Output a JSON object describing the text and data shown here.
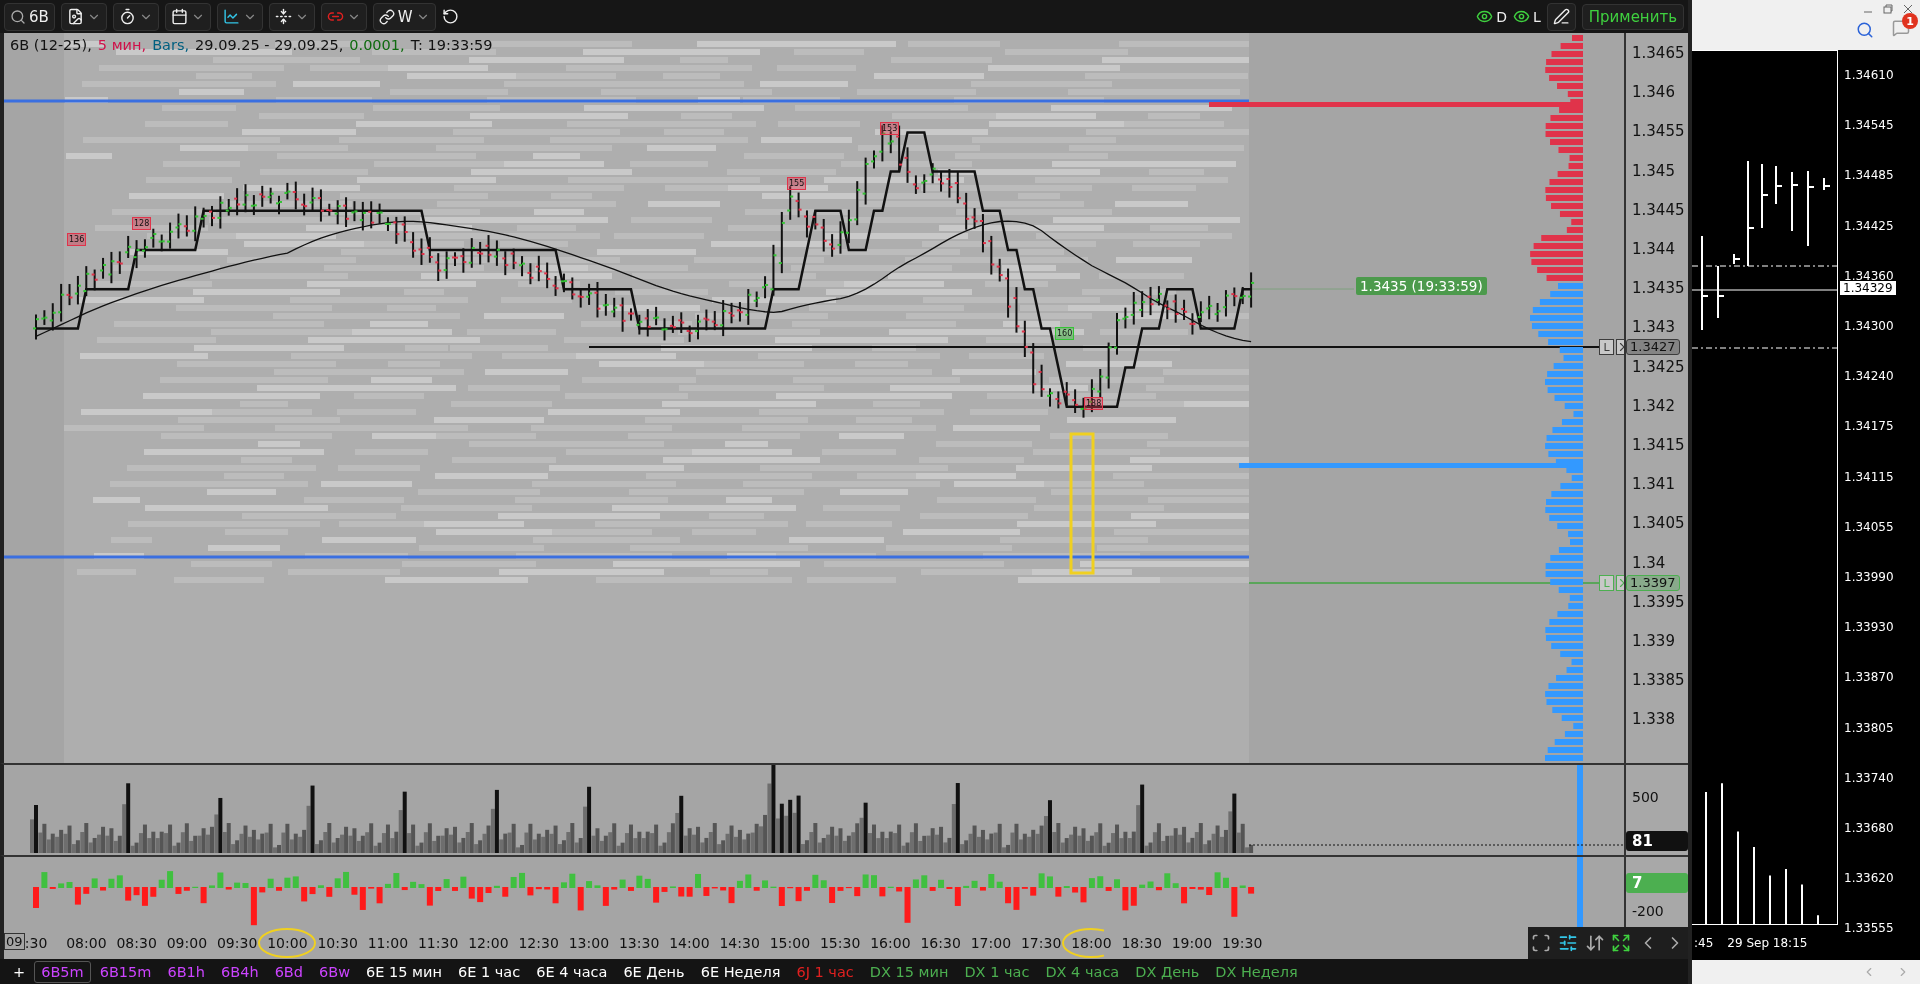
{
  "toolbar": {
    "symbol": "6B",
    "link_label": "W",
    "toggles": [
      {
        "label": "D",
        "on": true
      },
      {
        "label": "L",
        "on": true
      }
    ],
    "apply_button": "Применить"
  },
  "chart_info": [
    {
      "kind": "symbol",
      "text": "6B  (12-25),"
    },
    {
      "kind": "interval",
      "text": "5 мин,"
    },
    {
      "kind": "type",
      "text": "Bars,"
    },
    {
      "kind": "range",
      "text": "29.09.25 - 29.09.25,"
    },
    {
      "kind": "tick",
      "text": "0.0001,"
    },
    {
      "kind": "time",
      "text": "T: 19:33:59"
    }
  ],
  "trade_markers": [
    {
      "label": "136",
      "kind": "sell"
    },
    {
      "label": "128",
      "kind": "sell"
    },
    {
      "label": "155",
      "kind": "sell"
    },
    {
      "label": "153",
      "kind": "sell"
    },
    {
      "label": "160",
      "kind": "buy"
    },
    {
      "label": "138",
      "kind": "sell"
    }
  ],
  "last_price_tag": "1.3435 (19:33:59)",
  "price_axis": {
    "labels": [
      "1.3465",
      "1.346",
      "1.3455",
      "1.345",
      "1.3445",
      "1.344",
      "1.3435",
      "1.343",
      "1.3425",
      "1.342",
      "1.3415",
      "1.341",
      "1.3405",
      "1.34",
      "1.3395",
      "1.339",
      "1.3385",
      "1.338"
    ]
  },
  "order_lines": [
    {
      "price": "1.3427",
      "button": "L",
      "color": "#3c3c3c"
    },
    {
      "price": "1.3397",
      "button": "L",
      "color": "#4caf50"
    }
  ],
  "volume_axis": {
    "label": "500",
    "last": "81"
  },
  "delta_axis": {
    "last": "7",
    "label": "-200"
  },
  "time_axis": {
    "date_box": "09",
    "labels": [
      ":30",
      "08:00",
      "08:30",
      "09:00",
      "09:30",
      "10:00",
      "10:30",
      "11:00",
      "11:30",
      "12:00",
      "12:30",
      "13:00",
      "13:30",
      "14:00",
      "14:30",
      "15:00",
      "15:30",
      "16:00",
      "16:30",
      "17:00",
      "17:30",
      "18:00",
      "18:30",
      "19:00",
      "19:30"
    ]
  },
  "tabs": [
    {
      "label": "+",
      "color": "#ffffff",
      "selected": false
    },
    {
      "label": "6B5m",
      "color": "#cc44ff",
      "selected": true
    },
    {
      "label": "6B15m",
      "color": "#cc44ff",
      "selected": false
    },
    {
      "label": "6B1h",
      "color": "#cc44ff",
      "selected": false
    },
    {
      "label": "6B4h",
      "color": "#cc44ff",
      "selected": false
    },
    {
      "label": "6Bd",
      "color": "#cc44ff",
      "selected": false
    },
    {
      "label": "6Bw",
      "color": "#cc44ff",
      "selected": false
    },
    {
      "label": "6E 15 мин",
      "color": "#ffffff",
      "selected": false
    },
    {
      "label": "6E 1 час",
      "color": "#ffffff",
      "selected": false
    },
    {
      "label": "6E 4 часа",
      "color": "#ffffff",
      "selected": false
    },
    {
      "label": "6E День",
      "color": "#ffffff",
      "selected": false
    },
    {
      "label": "6E Неделя",
      "color": "#ffffff",
      "selected": false
    },
    {
      "label": "6J 1 час",
      "color": "#e02020",
      "selected": false
    },
    {
      "label": "DX 15 мин",
      "color": "#4caf50",
      "selected": false
    },
    {
      "label": "DX 1 час",
      "color": "#4caf50",
      "selected": false
    },
    {
      "label": "DX 4 часа",
      "color": "#4caf50",
      "selected": false
    },
    {
      "label": "DX День",
      "color": "#4caf50",
      "selected": false
    },
    {
      "label": "DX Неделя",
      "color": "#4caf50",
      "selected": false
    }
  ],
  "side_chart": {
    "notification_count": "1",
    "price_labels": [
      "1.34610",
      "1.34545",
      "1.34485",
      "1.34425",
      "1.34360",
      "1.34300",
      "1.34240",
      "1.34175",
      "1.34115",
      "1.34055",
      "1.33990",
      "1.33930",
      "1.33870",
      "1.33805",
      "1.33740",
      "1.33680",
      "1.33620",
      "1.33555"
    ],
    "current_price": "1.34329",
    "time_labels": [
      ":45",
      "29 Sep 18:15"
    ]
  }
}
